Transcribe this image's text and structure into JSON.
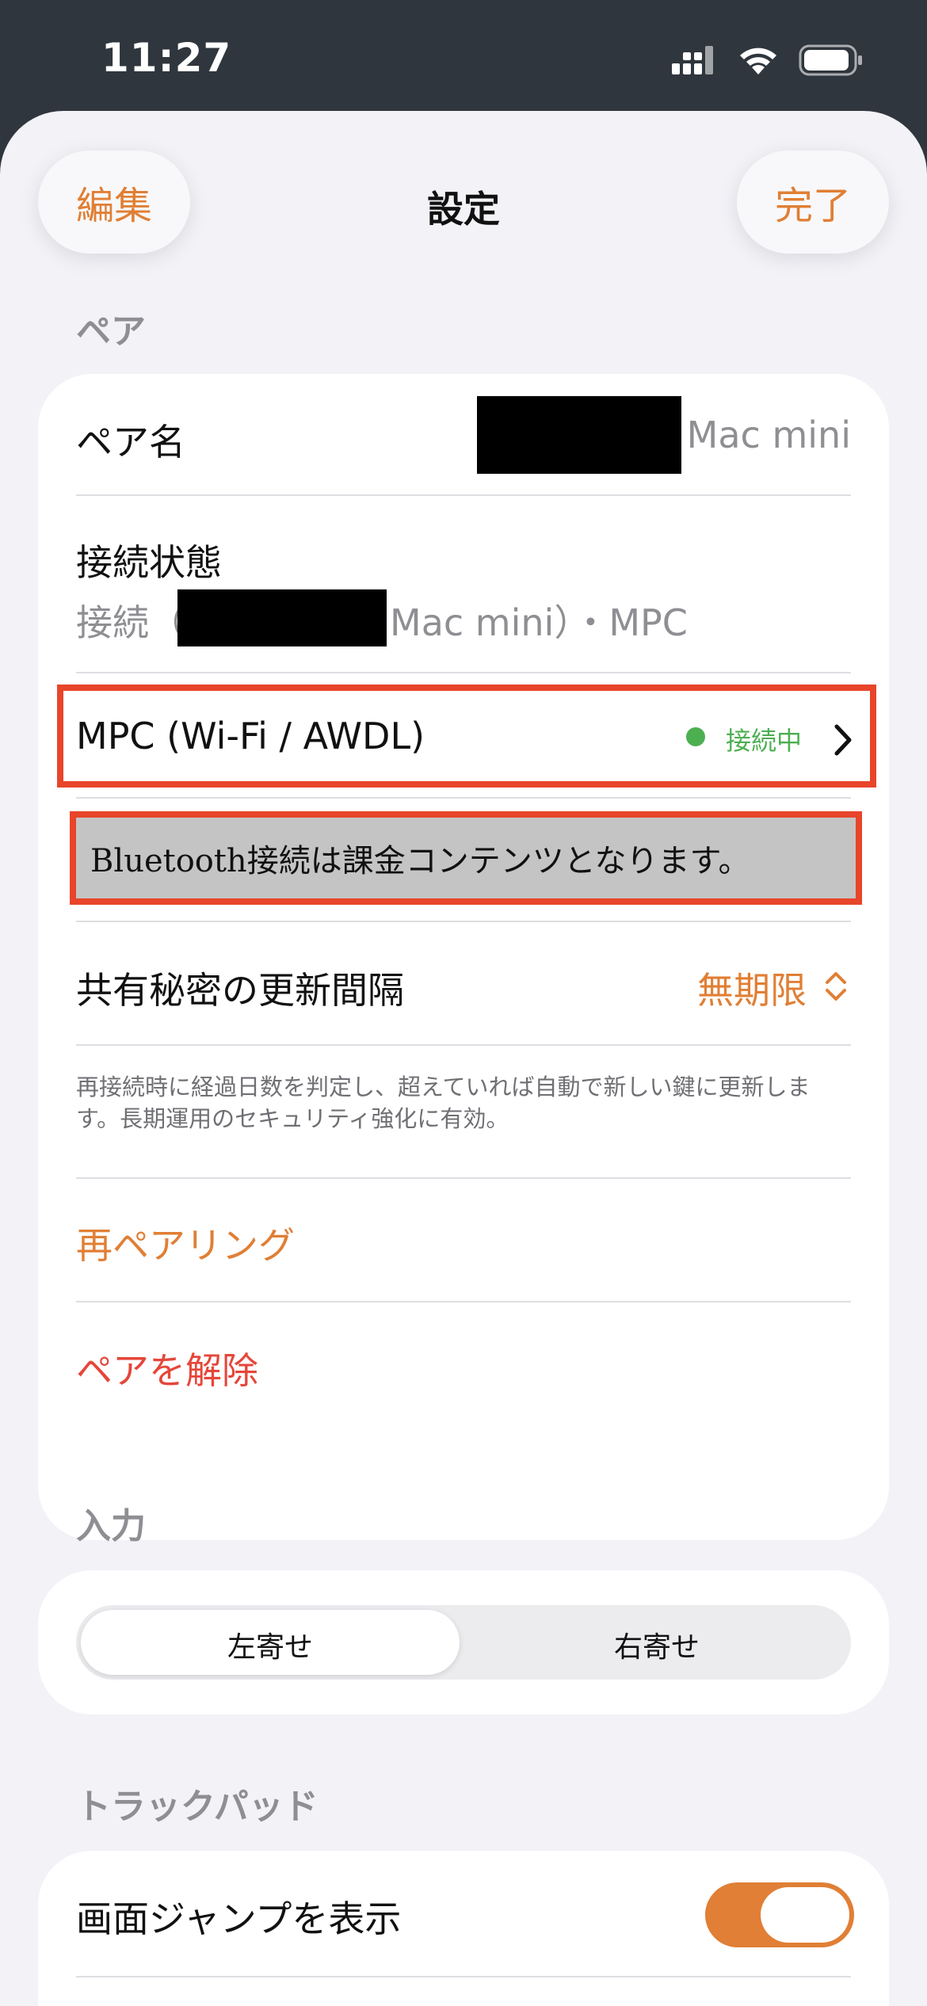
{
  "colors": {
    "accent": "#e07f35",
    "danger": "#e5463a",
    "green": "#4caf50",
    "status_bg": "#2f363d",
    "sheet_bg": "#f2f2f7"
  },
  "status_bar": {
    "time": "11:27",
    "icons": [
      "signal-icon",
      "wifi-icon",
      "battery-icon"
    ]
  },
  "nav": {
    "edit_label": "編集",
    "title": "設定",
    "done_label": "完了"
  },
  "pair_section": {
    "header": "ペア",
    "pair_name_label": "ペア名",
    "pair_name_value": "Mac mini",
    "connection_label": "接続状態",
    "connection_prefix": "接続（",
    "connection_suffix": "Mac mini）・MPC",
    "mpc_label": "MPC (Wi-Fi / AWDL)",
    "mpc_status": "接続中",
    "bluetooth_note": "Bluetooth接続は課金コンテンツとなります。",
    "rekey_label": "共有秘密の更新間隔",
    "rekey_value": "無期限",
    "rekey_footnote": "再接続時に経過日数を判定し、超えていれば自動で新しい鍵に更新します。長期運用のセキュリティ強化に有効。",
    "repair_label": "再ペアリング",
    "unpair_label": "ペアを解除"
  },
  "input_section": {
    "header": "入力",
    "left_label": "左寄せ",
    "right_label": "右寄せ",
    "selected": "左寄せ"
  },
  "trackpad_section": {
    "header": "トラックパッド",
    "screen_jump_label": "画面ジャンプを表示",
    "screen_jump_on": true
  }
}
